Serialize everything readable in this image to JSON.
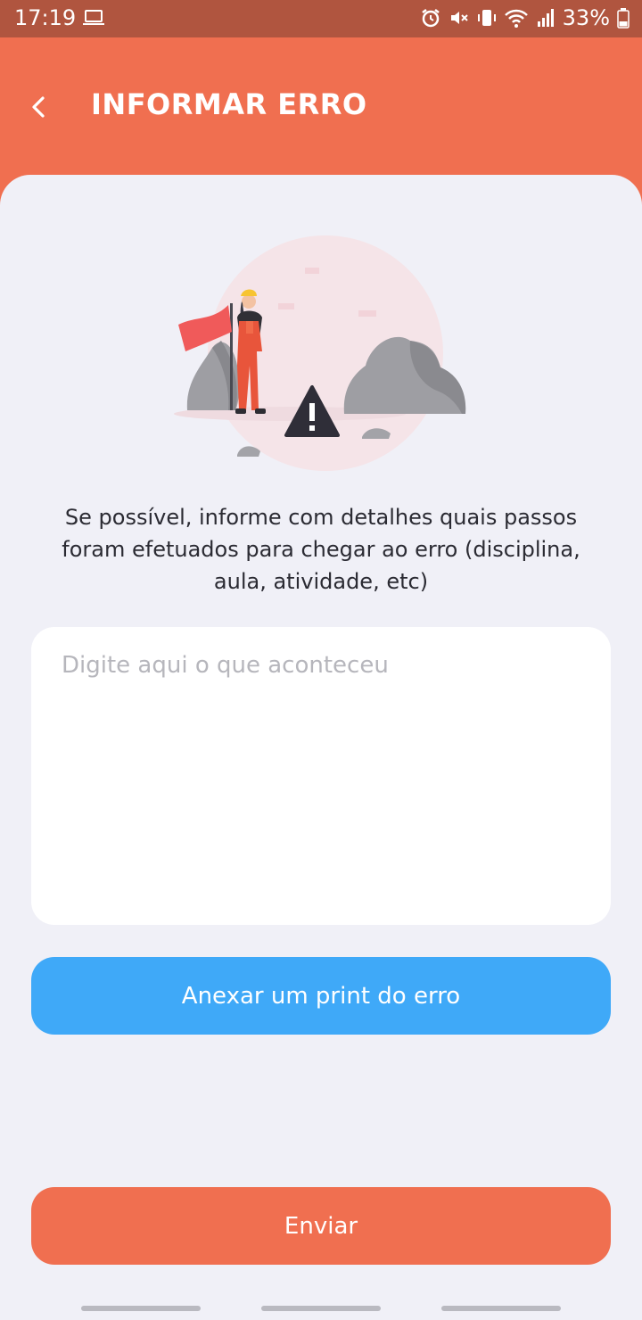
{
  "status_bar": {
    "time": "17:19",
    "battery": "33%",
    "icons": [
      "laptop-icon",
      "alarm-icon",
      "mute-icon",
      "vibrate-icon",
      "wifi-icon",
      "signal-icon",
      "battery-icon"
    ]
  },
  "header": {
    "title": "INFORMAR ERRO",
    "back_icon": "chevron-left-icon"
  },
  "content": {
    "description": "Se possível, informe com detalhes quais passos foram efetuados para chegar ao erro (disciplina, aula, atividade, etc)",
    "textarea_placeholder": "Digite aqui o que aconteceu",
    "textarea_value": ""
  },
  "buttons": {
    "attach_label": "Anexar um print do erro",
    "send_label": "Enviar"
  },
  "colors": {
    "primary": "#f06f50",
    "status_bar": "#b0553f",
    "attach": "#3fa9f8",
    "background": "#f0f0f7"
  }
}
